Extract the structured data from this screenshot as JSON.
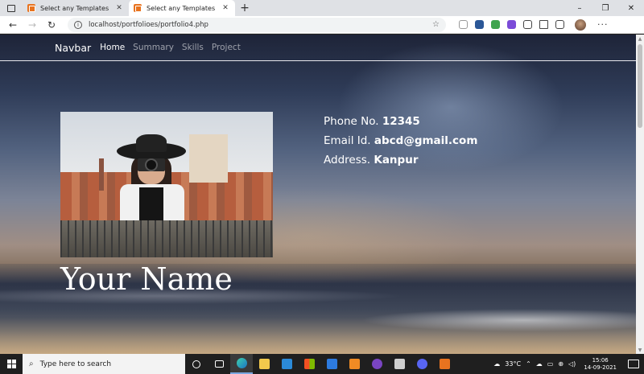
{
  "browser": {
    "tabs": [
      {
        "title": "Select any Templates",
        "active": false
      },
      {
        "title": "Select any Templates",
        "active": true
      }
    ],
    "new_tab": "+",
    "window_controls": {
      "minimize": "–",
      "maximize": "❐",
      "close": "✕"
    },
    "address": "localhost/portfolioes/portfolio4.php",
    "back": "←",
    "forward": "→",
    "reload": "↻",
    "more": "···",
    "accent_color": "#e8731f"
  },
  "site": {
    "navbar": {
      "brand": "Navbar",
      "links": [
        "Home",
        "Summary",
        "Skills",
        "Project"
      ],
      "active": "Home"
    },
    "contact": {
      "phone_label": "Phone No.",
      "phone_value": "12345",
      "email_label": "Email Id.",
      "email_value": "abcd@gmail.com",
      "address_label": "Address.",
      "address_value": "Kanpur"
    },
    "name": "Your Name"
  },
  "taskbar": {
    "search_placeholder": "Type here to search",
    "temperature": "33°C",
    "time": "15:06",
    "date": "14-09-2021"
  }
}
